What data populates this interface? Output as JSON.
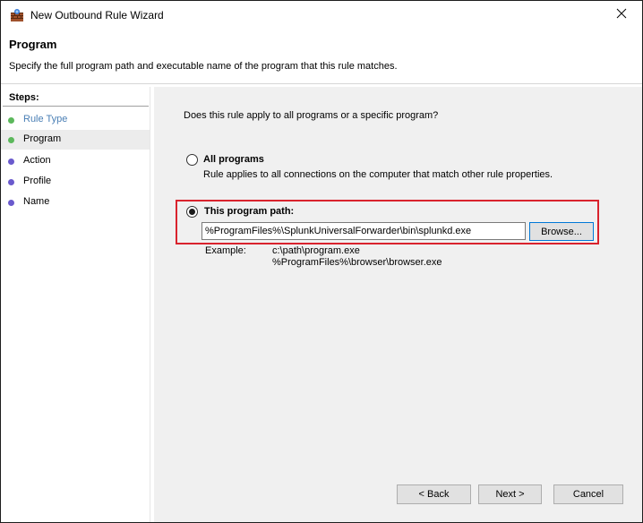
{
  "window": {
    "title": "New Outbound Rule Wizard",
    "close_glyph": "✕"
  },
  "header": {
    "title": "Program",
    "description": "Specify the full program path and executable name of the program that this rule matches."
  },
  "sidebar": {
    "steps_title": "Steps:",
    "items": [
      {
        "label": "Rule Type",
        "state": "done",
        "color": "#4a7fb5",
        "dot_color": "#5cb85c"
      },
      {
        "label": "Program",
        "state": "current",
        "color": "#000000",
        "dot_color": "#5cb85c"
      },
      {
        "label": "Action",
        "state": "pending",
        "color": "#000000",
        "dot_color": "#6a5acd"
      },
      {
        "label": "Profile",
        "state": "pending",
        "color": "#000000",
        "dot_color": "#6a5acd"
      },
      {
        "label": "Name",
        "state": "pending",
        "color": "#000000",
        "dot_color": "#6a5acd"
      }
    ]
  },
  "main": {
    "question": "Does this rule apply to all programs or a specific program?",
    "all_programs": {
      "label": "All programs",
      "description": "Rule applies to all connections on the computer that match other rule properties.",
      "selected": false
    },
    "this_program": {
      "label": "This program path:",
      "selected": true,
      "path_value": "%ProgramFiles%\\SplunkUniversalForwarder\\bin\\splunkd.exe",
      "browse_label": "Browse..."
    },
    "example": {
      "label": "Example:",
      "lines": [
        "c:\\path\\program.exe",
        "%ProgramFiles%\\browser\\browser.exe"
      ]
    }
  },
  "footer": {
    "back_label": "< Back",
    "next_label": "Next >",
    "cancel_label": "Cancel"
  },
  "colors": {
    "highlight": "#d9232d",
    "focus_blue": "#0078d7",
    "panel_bg": "#f0f0f0"
  },
  "icons": {
    "app": "firewall-wall-icon",
    "close": "close-icon"
  }
}
